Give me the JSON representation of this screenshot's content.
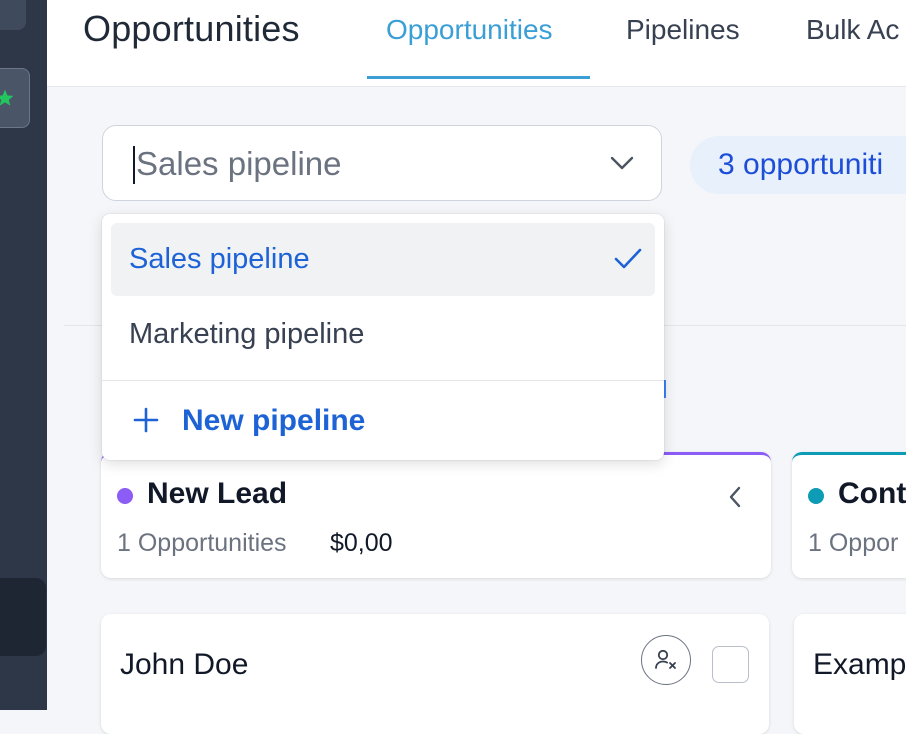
{
  "header": {
    "title": "Opportunities",
    "tabs": [
      {
        "label": "Opportunities",
        "active": true
      },
      {
        "label": "Pipelines",
        "active": false
      },
      {
        "label": "Bulk Ac",
        "active": false
      }
    ]
  },
  "pipeline_select": {
    "value": "Sales pipeline",
    "options": [
      {
        "label": "Sales pipeline",
        "selected": true
      },
      {
        "label": "Marketing pipeline",
        "selected": false
      }
    ],
    "new_label": "New pipeline"
  },
  "count_badge": "3 opportuniti",
  "stages": [
    {
      "name": "New Lead",
      "count_text": "1 Opportunities",
      "amount": "$0,00",
      "color": "#8b5cf6"
    },
    {
      "name": "Cont",
      "count_text": "1 Oppor",
      "amount": "",
      "color": "#0e9bb5"
    }
  ],
  "cards": [
    {
      "name": "John Doe"
    },
    {
      "name": "Examp"
    }
  ],
  "colors": {
    "accent": "#3b9fd6",
    "link": "#1d63d6",
    "rail": "#2d3748"
  }
}
